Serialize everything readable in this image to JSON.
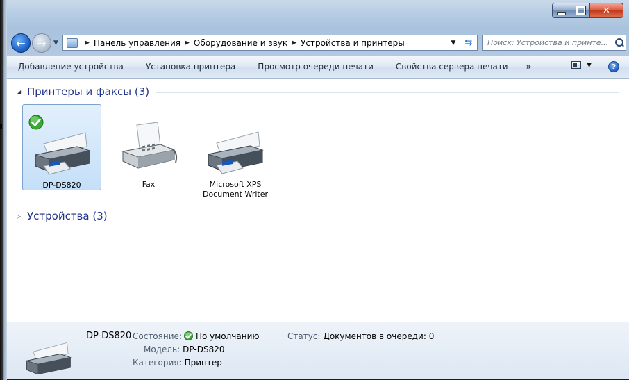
{
  "address": {
    "crumbs": [
      "Панель управления",
      "Оборудование и звук",
      "Устройства и принтеры"
    ],
    "search_placeholder": "Поиск: Устройства и принте..."
  },
  "toolbar": {
    "commands": [
      "Добавление устройства",
      "Установка принтера",
      "Просмотр очереди печати",
      "Свойства сервера печати"
    ],
    "more": "»"
  },
  "groups": {
    "printers": {
      "arrow": "◢",
      "label": "Принтеры и факсы (3)"
    },
    "devices": {
      "arrow": "▷",
      "label": "Устройства (3)"
    }
  },
  "devices": [
    {
      "name": "DP-DS820",
      "selected": true,
      "default": true
    },
    {
      "name": "Fax",
      "selected": false,
      "default": false
    },
    {
      "name": "Microsoft XPS Document Writer",
      "selected": false,
      "default": false
    }
  ],
  "details": {
    "name": "DP-DS820",
    "state_label": "Состояние:",
    "state_value": "По умолчанию",
    "status_label": "Статус:",
    "status_value": "Документов в очереди: 0",
    "model_label": "Модель:",
    "model_value": "DP-DS820",
    "category_label": "Категория:",
    "category_value": "Принтер"
  },
  "colors": {
    "group_header": "#1e3287",
    "selection": "#c4dff8",
    "close_button": "#c2391c"
  }
}
